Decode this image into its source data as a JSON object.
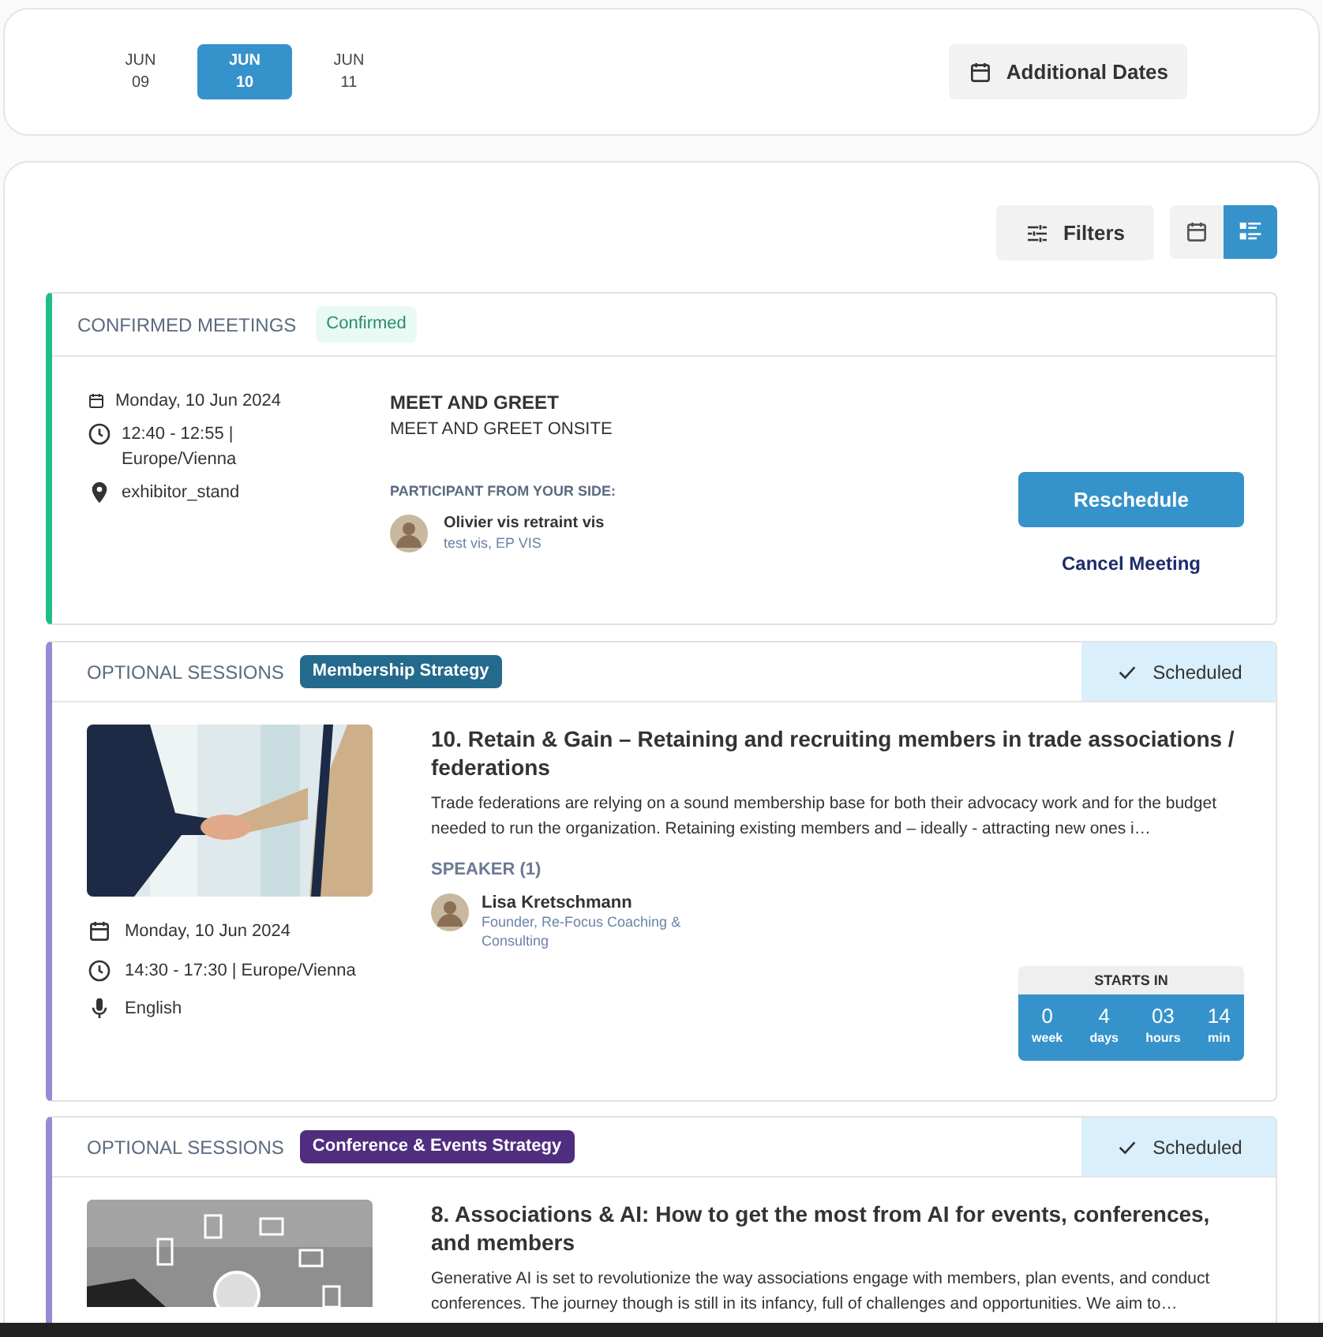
{
  "date_tabs": [
    {
      "month": "JUN",
      "day": "09",
      "selected": false
    },
    {
      "month": "JUN",
      "day": "10",
      "selected": true
    },
    {
      "month": "JUN",
      "day": "11",
      "selected": false
    }
  ],
  "additional_dates": "Additional Dates",
  "filters": "Filters",
  "view_toggle": [
    {
      "kind": "calendar",
      "selected": false
    },
    {
      "kind": "list",
      "selected": true
    }
  ],
  "meeting": {
    "section": "CONFIRMED MEETINGS",
    "status": "Confirmed",
    "date": "Monday, 10 Jun 2024",
    "time": "12:40 - 12:55 | Europe/Vienna",
    "location": "exhibitor_stand",
    "title": "MEET AND GREET",
    "subtitle": "MEET AND GREET ONSITE",
    "participant_label": "PARTICIPANT FROM YOUR SIDE:",
    "participant_name": "Olivier vis retraint vis",
    "participant_role": "test vis, EP VIS",
    "reschedule": "Reschedule",
    "cancel": "Cancel Meeting"
  },
  "sessions": [
    {
      "section": "OPTIONAL SESSIONS",
      "tag": "Membership Strategy",
      "color": "#236a8c",
      "status": "Scheduled",
      "title": "10. Retain & Gain – Retaining and recruiting members in trade associations / federations",
      "description": "Trade federations are relying on a sound membership base for both their advocacy work and for the budget needed to run the organization. Retaining existing members and – ideally -  attracting new ones i…",
      "speaker_label": "SPEAKER (1)",
      "speaker_name": "Lisa Kretschmann",
      "speaker_role": "Founder, Re-Focus Coaching & Consulting",
      "date": "Monday, 10 Jun 2024",
      "time": "14:30 - 17:30 | Europe/Vienna",
      "language": "English",
      "starts_in": "STARTS IN",
      "countdown": [
        {
          "value": "0",
          "unit": "week"
        },
        {
          "value": "4",
          "unit": "days"
        },
        {
          "value": "03",
          "unit": "hours"
        },
        {
          "value": "14",
          "unit": "min"
        }
      ]
    },
    {
      "section": "OPTIONAL SESSIONS",
      "tag": "Conference & Events Strategy",
      "color": "#4f2d7f",
      "status": "Scheduled",
      "title": "8. Associations & AI: How to get the most from AI for events, conferences, and members",
      "description": "Generative AI is set to revolutionize the way associations engage with members, plan events, and conduct conferences. The journey though is still in its infancy, full of challenges and opportunities. We aim to…"
    }
  ]
}
